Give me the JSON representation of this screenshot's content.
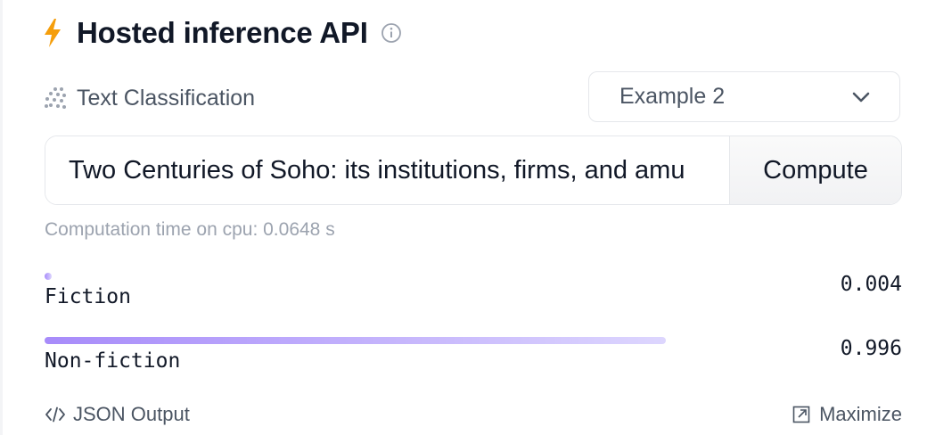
{
  "widget": {
    "title": "Hosted inference API",
    "task_label": "Text Classification",
    "example_select": {
      "selected": "Example 2"
    },
    "input": {
      "value": "Two Centuries of Soho: its institutions, firms, and amu"
    },
    "compute_label": "Compute",
    "computation_time": "Computation time on cpu: 0.0648 s",
    "results": [
      {
        "label": "Fiction",
        "score_text": "0.004",
        "score": 0.004
      },
      {
        "label": "Non-fiction",
        "score_text": "0.996",
        "score": 0.996
      }
    ],
    "footer": {
      "json_output": "JSON Output",
      "maximize": "Maximize"
    }
  },
  "colors": {
    "accent_bolt": "#f59e0b",
    "bar_start": "#a78bfa",
    "bar_end": "#ddd6fe"
  },
  "icons": [
    "bolt-icon",
    "info-icon",
    "dots-grid-icon",
    "chevron-down-icon",
    "code-icon",
    "maximize-icon"
  ]
}
